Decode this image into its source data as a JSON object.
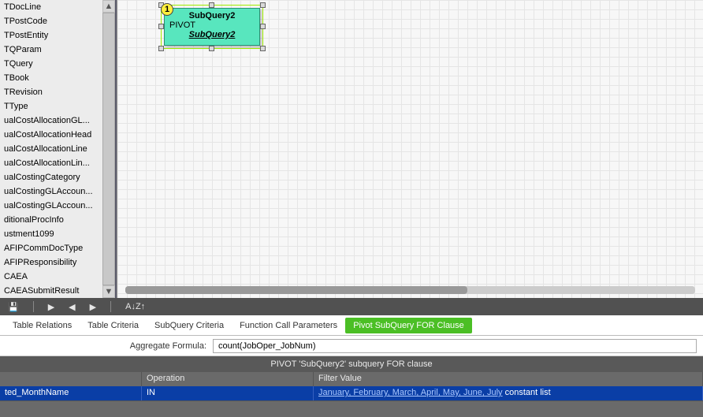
{
  "sidebar": {
    "items": [
      "TDocLine",
      "TPostCode",
      "TPostEntity",
      "TQParam",
      "TQuery",
      "TBook",
      "TRevision",
      "TType",
      "ualCostAllocationGL...",
      "ualCostAllocationHead",
      "ualCostAllocationLine",
      "ualCostAllocationLin...",
      "ualCostingCategory",
      "ualCostingGLAccoun...",
      "ualCostingGLAccoun...",
      "ditionalProcInfo",
      "ustment1099",
      "AFIPCommDocType",
      "AFIPResponsibility",
      "CAEA",
      "CAEASubmitResult"
    ]
  },
  "pivot": {
    "badge": "1",
    "title": "SubQuery2",
    "keyword": "PIVOT",
    "subquery_link": "SubQuery2"
  },
  "nav": {
    "group_save": "💾",
    "play": "▶",
    "prev": "◀",
    "next": "▶",
    "sort": "A↓Z↑"
  },
  "tabs": {
    "items": [
      {
        "label": "Table Relations"
      },
      {
        "label": "Table Criteria"
      },
      {
        "label": "SubQuery Criteria"
      },
      {
        "label": "Function Call Parameters"
      },
      {
        "label": "Pivot SubQuery FOR Clause",
        "active": true
      }
    ]
  },
  "aggregate": {
    "label": "Aggregate Formula:",
    "value": "count(JobOper_JobNum)"
  },
  "grid": {
    "title": "PIVOT 'SubQuery2' subquery FOR clause",
    "headers": {
      "field": "",
      "operation": "Operation",
      "filter_value": "Filter Value"
    },
    "row": {
      "field": "ted_MonthName",
      "operation": "IN",
      "value_link": "January, February, March, April, May, June, July",
      "value_tail": " constant list"
    }
  }
}
